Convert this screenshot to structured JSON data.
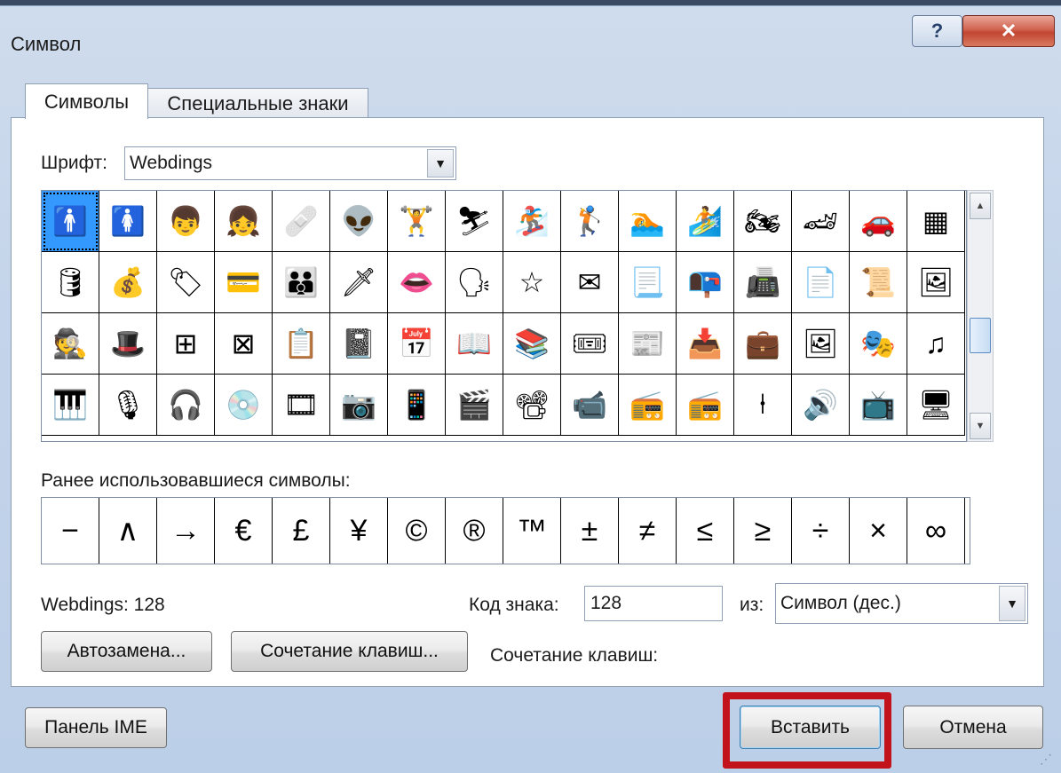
{
  "dialog": {
    "title": "Символ",
    "help_icon_glyph": "?",
    "close_icon_glyph": "✕"
  },
  "tabs": [
    {
      "label": "Символы",
      "active": true
    },
    {
      "label": "Специальные знаки",
      "active": false
    }
  ],
  "font": {
    "label": "Шрифт:",
    "value": "Webdings"
  },
  "symbol_grid": {
    "selected_index": 0,
    "rows": [
      [
        "man-icon",
        "woman-icon",
        "boy-icon",
        "girl-icon",
        "bandage-icon",
        "alien-head-icon",
        "weightlifter-icon",
        "skier-icon",
        "snowboarder-icon",
        "golfer-icon",
        "swimmer-icon",
        "surfer-icon",
        "motorcycle-icon",
        "race-car-icon",
        "car-icon",
        "chart-grid-icon"
      ],
      [
        "coin-stack-icon",
        "money-bag-icon",
        "tag-icon",
        "credit-card-icon",
        "group-people-icon",
        "dagger-icon",
        "lips-icon",
        "speaking-head-icon",
        "star-outline-icon",
        "envelope-icon",
        "document-lines-icon",
        "mail-slot-icon",
        "fax-icon",
        "page-icon",
        "certificate-icon",
        "picture-frame-icon"
      ],
      [
        "spy-icon",
        "hat-icon",
        "window-frame-icon",
        "frame-cross-icon",
        "clipboard-icon",
        "notepad-icon",
        "calendar-icon",
        "open-book-icon",
        "books-stack-icon",
        "ticket-icon",
        "newspaper-icon",
        "tray-icon",
        "briefcase-icon",
        "portrait-icon",
        "theater-masks-icon",
        "music-note-icon"
      ],
      [
        "keyboard-instrument-icon",
        "microphone-icon",
        "headphones-icon",
        "compact-disc-icon",
        "film-strip-icon",
        "camera-icon",
        "remote-control-icon",
        "clapperboard-icon",
        "film-projector-icon",
        "video-camera-icon",
        "boombox-icon",
        "radio-icon",
        "fader-icon",
        "speaker-icon",
        "tv-icon",
        "monitor-icon"
      ]
    ],
    "glyphs": [
      [
        "🚹",
        "🚺",
        "👦",
        "👧",
        "🩹",
        "👽",
        "🏋",
        "⛷",
        "🏂",
        "🏌",
        "🏊",
        "🏄",
        "🏍",
        "🏎",
        "🚗",
        "▦"
      ],
      [
        "🛢",
        "💰",
        "🏷",
        "💳",
        "👪",
        "🗡",
        "👄",
        "🗣",
        "☆",
        "✉",
        "📃",
        "📭",
        "📠",
        "📄",
        "📜",
        "🖼"
      ],
      [
        "🕵",
        "🎩",
        "⊞",
        "⊠",
        "📋",
        "📓",
        "📅",
        "📖",
        "📚",
        "🎟",
        "📰",
        "📥",
        "💼",
        "🖼",
        "🎭",
        "♫"
      ],
      [
        "🎹",
        "🎙",
        "🎧",
        "💿",
        "🎞",
        "📷",
        "📱",
        "🎬",
        "📽",
        "📹",
        "📻",
        "📻",
        "⍿",
        "🔊",
        "📺",
        "🖥"
      ]
    ]
  },
  "recent": {
    "label": "Ранее использовавшиеся символы:",
    "symbols": [
      "−",
      "∧",
      "→",
      "€",
      "£",
      "¥",
      "©",
      "®",
      "™",
      "±",
      "≠",
      "≤",
      "≥",
      "÷",
      "×",
      "∞"
    ]
  },
  "info": {
    "font_code_text": "Webdings: 128",
    "code_label": "Код знака:",
    "code_value": "128",
    "from_label": "из:",
    "from_value": "Символ (дес.)",
    "shortcut_label": "Сочетание клавиш:"
  },
  "buttons": {
    "autocorrect": "Автозамена...",
    "shortcut_key": "Сочетание клавиш...",
    "ime_panel": "Панель IME",
    "insert": "Вставить",
    "cancel": "Отмена"
  },
  "colors": {
    "selection": "#3399ff",
    "highlight_frame": "#c2131c",
    "close_button": "#c24632"
  }
}
